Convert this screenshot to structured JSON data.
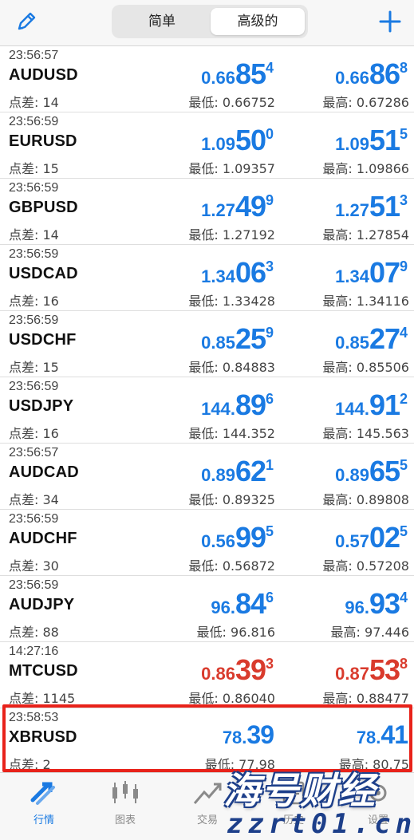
{
  "header": {
    "tabs": [
      "简单",
      "高级的"
    ],
    "active_tab": 1,
    "edit_icon": "pencil-icon",
    "add_icon": "plus-icon",
    "accent": "#1a7ae2"
  },
  "quotes": [
    {
      "time": "23:56:57",
      "symbol": "AUDUSD",
      "spread": "点差: 14",
      "bid": {
        "small": "0.66",
        "big": "85",
        "sup": "4"
      },
      "ask": {
        "small": "0.66",
        "big": "86",
        "sup": "8"
      },
      "low": "最低: 0.66752",
      "high": "最高: 0.67286",
      "color": "blue"
    },
    {
      "time": "23:56:59",
      "symbol": "EURUSD",
      "spread": "点差: 15",
      "bid": {
        "small": "1.09",
        "big": "50",
        "sup": "0"
      },
      "ask": {
        "small": "1.09",
        "big": "51",
        "sup": "5"
      },
      "low": "最低: 1.09357",
      "high": "最高: 1.09866",
      "color": "blue"
    },
    {
      "time": "23:56:59",
      "symbol": "GBPUSD",
      "spread": "点差: 14",
      "bid": {
        "small": "1.27",
        "big": "49",
        "sup": "9"
      },
      "ask": {
        "small": "1.27",
        "big": "51",
        "sup": "3"
      },
      "low": "最低: 1.27192",
      "high": "最高: 1.27854",
      "color": "blue"
    },
    {
      "time": "23:56:59",
      "symbol": "USDCAD",
      "spread": "点差: 16",
      "bid": {
        "small": "1.34",
        "big": "06",
        "sup": "3"
      },
      "ask": {
        "small": "1.34",
        "big": "07",
        "sup": "9"
      },
      "low": "最低: 1.33428",
      "high": "最高: 1.34116",
      "color": "blue"
    },
    {
      "time": "23:56:59",
      "symbol": "USDCHF",
      "spread": "点差: 15",
      "bid": {
        "small": "0.85",
        "big": "25",
        "sup": "9"
      },
      "ask": {
        "small": "0.85",
        "big": "27",
        "sup": "4"
      },
      "low": "最低: 0.84883",
      "high": "最高: 0.85506",
      "color": "blue"
    },
    {
      "time": "23:56:59",
      "symbol": "USDJPY",
      "spread": "点差: 16",
      "bid": {
        "small": "144.",
        "big": "89",
        "sup": "6"
      },
      "ask": {
        "small": "144.",
        "big": "91",
        "sup": "2"
      },
      "low": "最低: 144.352",
      "high": "最高: 145.563",
      "color": "blue"
    },
    {
      "time": "23:56:57",
      "symbol": "AUDCAD",
      "spread": "点差: 34",
      "bid": {
        "small": "0.89",
        "big": "62",
        "sup": "1"
      },
      "ask": {
        "small": "0.89",
        "big": "65",
        "sup": "5"
      },
      "low": "最低: 0.89325",
      "high": "最高: 0.89808",
      "color": "blue"
    },
    {
      "time": "23:56:59",
      "symbol": "AUDCHF",
      "spread": "点差: 30",
      "bid": {
        "small": "0.56",
        "big": "99",
        "sup": "5"
      },
      "ask": {
        "small": "0.57",
        "big": "02",
        "sup": "5"
      },
      "low": "最低: 0.56872",
      "high": "最高: 0.57208",
      "color": "blue"
    },
    {
      "time": "23:56:59",
      "symbol": "AUDJPY",
      "spread": "点差: 88",
      "bid": {
        "small": "96.",
        "big": "84",
        "sup": "6"
      },
      "ask": {
        "small": "96.",
        "big": "93",
        "sup": "4"
      },
      "low": "最低: 96.816",
      "high": "最高: 97.446",
      "color": "blue"
    },
    {
      "time": "14:27:16",
      "symbol": "MTCUSD",
      "spread": "点差: 1145",
      "bid": {
        "small": "0.86",
        "big": "39",
        "sup": "3"
      },
      "ask": {
        "small": "0.87",
        "big": "53",
        "sup": "8"
      },
      "low": "最低: 0.86040",
      "high": "最高: 0.88477",
      "color": "red"
    },
    {
      "time": "23:58:53",
      "symbol": "XBRUSD",
      "spread": "点差: 2",
      "bid": {
        "small": "78.",
        "big": "39",
        "sup": ""
      },
      "ask": {
        "small": "78.",
        "big": "41",
        "sup": ""
      },
      "low": "最低: 77.98",
      "high": "最高: 80.75",
      "color": "blue"
    }
  ],
  "tabbar": {
    "items": [
      {
        "label": "行情",
        "icon": "quotes-arrows-icon"
      },
      {
        "label": "图表",
        "icon": "candlestick-chart-icon"
      },
      {
        "label": "交易",
        "icon": "trade-chart-icon"
      },
      {
        "label": "历史",
        "icon": "history-icon"
      },
      {
        "label": "设置",
        "icon": "settings-icon"
      }
    ],
    "active": 0
  },
  "watermark": {
    "cn": "海号财经",
    "url": "zzrt01.cn"
  }
}
